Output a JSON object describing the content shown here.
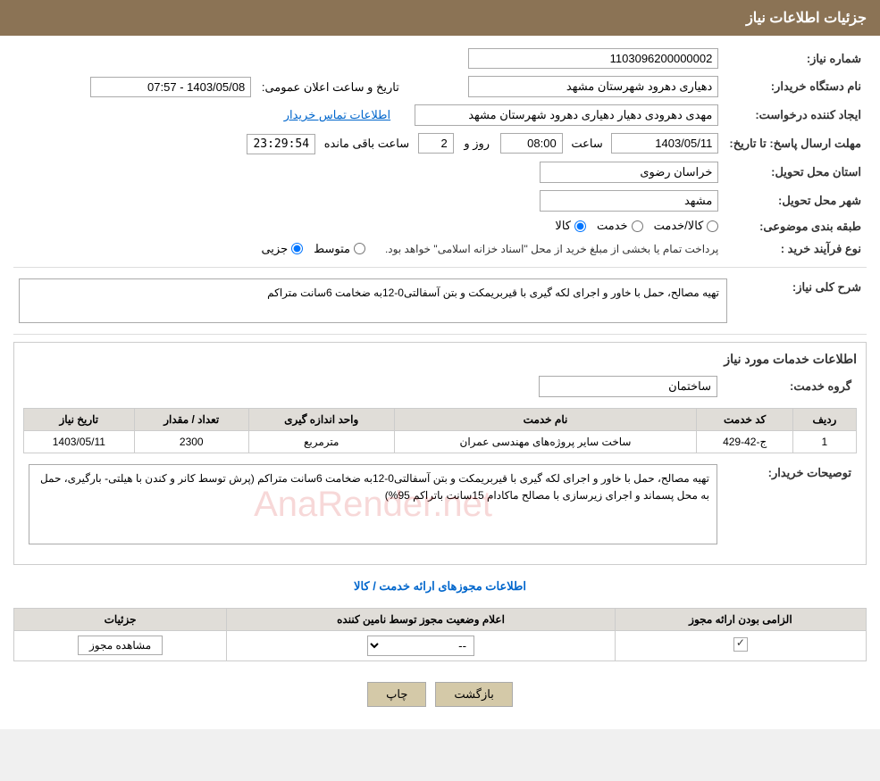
{
  "header": {
    "title": "جزئیات اطلاعات نیاز"
  },
  "fields": {
    "need_number_label": "شماره نیاز:",
    "need_number_value": "1103096200000002",
    "buyer_label": "نام دستگاه خریدار:",
    "buyer_value": "دهیاری دهرود شهرستان مشهد",
    "announce_label": "تاریخ و ساعت اعلان عمومی:",
    "announce_value": "1403/05/08 - 07:57",
    "creator_label": "ایجاد کننده درخواست:",
    "creator_value": "مهدی دهرودی دهیار دهیاری دهرود شهرستان مشهد",
    "contact_link": "اطلاعات تماس خریدار",
    "reply_deadline_label": "مهلت ارسال پاسخ: تا تاریخ:",
    "reply_date": "1403/05/11",
    "reply_time_label": "ساعت",
    "reply_time": "08:00",
    "reply_days_label": "روز و",
    "reply_days": "2",
    "countdown_label": "ساعت باقی مانده",
    "countdown": "23:29:54",
    "province_label": "استان محل تحویل:",
    "province_value": "خراسان رضوی",
    "city_label": "شهر محل تحویل:",
    "city_value": "مشهد",
    "category_label": "طبقه بندی موضوعی:",
    "category_kala": "کالا",
    "category_khadamat": "خدمت",
    "category_kala_khadamat": "کالا/خدمت",
    "purchase_type_label": "نوع فرآیند خرید :",
    "purchase_jozi": "جزیی",
    "purchase_motavasset": "متوسط",
    "purchase_desc": "پرداخت تمام یا بخشی از مبلغ خرید از محل \"اسناد خزانه اسلامی\" خواهد بود.",
    "general_desc_label": "شرح کلی نیاز:",
    "general_desc_value": "تهیه مصالح، حمل با خاور و اجرای لکه گیری با قیربریمکت و بتن آسفالتی0-12به ضخامت  6سانت متراکم",
    "services_title": "اطلاعات خدمات مورد نیاز",
    "service_group_label": "گروه خدمت:",
    "service_group_value": "ساختمان",
    "table_headers": {
      "row": "ردیف",
      "code": "کد خدمت",
      "name": "نام خدمت",
      "unit": "واحد اندازه گیری",
      "quantity": "تعداد / مقدار",
      "date": "تاریخ نیاز"
    },
    "table_rows": [
      {
        "row": "1",
        "code": "ج-42-429",
        "name": "ساخت سایر پروژه‌های مهندسی عمران",
        "unit": "مترمربع",
        "quantity": "2300",
        "date": "1403/05/11"
      }
    ],
    "buyer_desc_label": "توصیحات خریدار:",
    "buyer_desc_value": "تهیه مصالح، حمل با خاور و اجرای لکه گیری با قیربریمکت و بتن آسفالتی0-12به ضخامت  6سانت متراکم (پرش توسط کانر و کندن با هیلتی- بارگیری، حمل به محل پسماند و اجرای زیرسازی با مصالح ماکادام 15سانت باتراکم 95%)",
    "permits_link": "اطلاعات مجوزهای ارائه خدمت / کالا",
    "permits_table_headers": {
      "required": "الزامی بودن ارائه مجوز",
      "announce": "اعلام وضعیت مجوز توسط نامین کننده",
      "details": "جزئیات"
    },
    "permits_row": {
      "required_checked": true,
      "announce_value": "--",
      "details_btn": "مشاهده مجوز"
    },
    "btn_print": "چاپ",
    "btn_back": "بازگشت"
  }
}
